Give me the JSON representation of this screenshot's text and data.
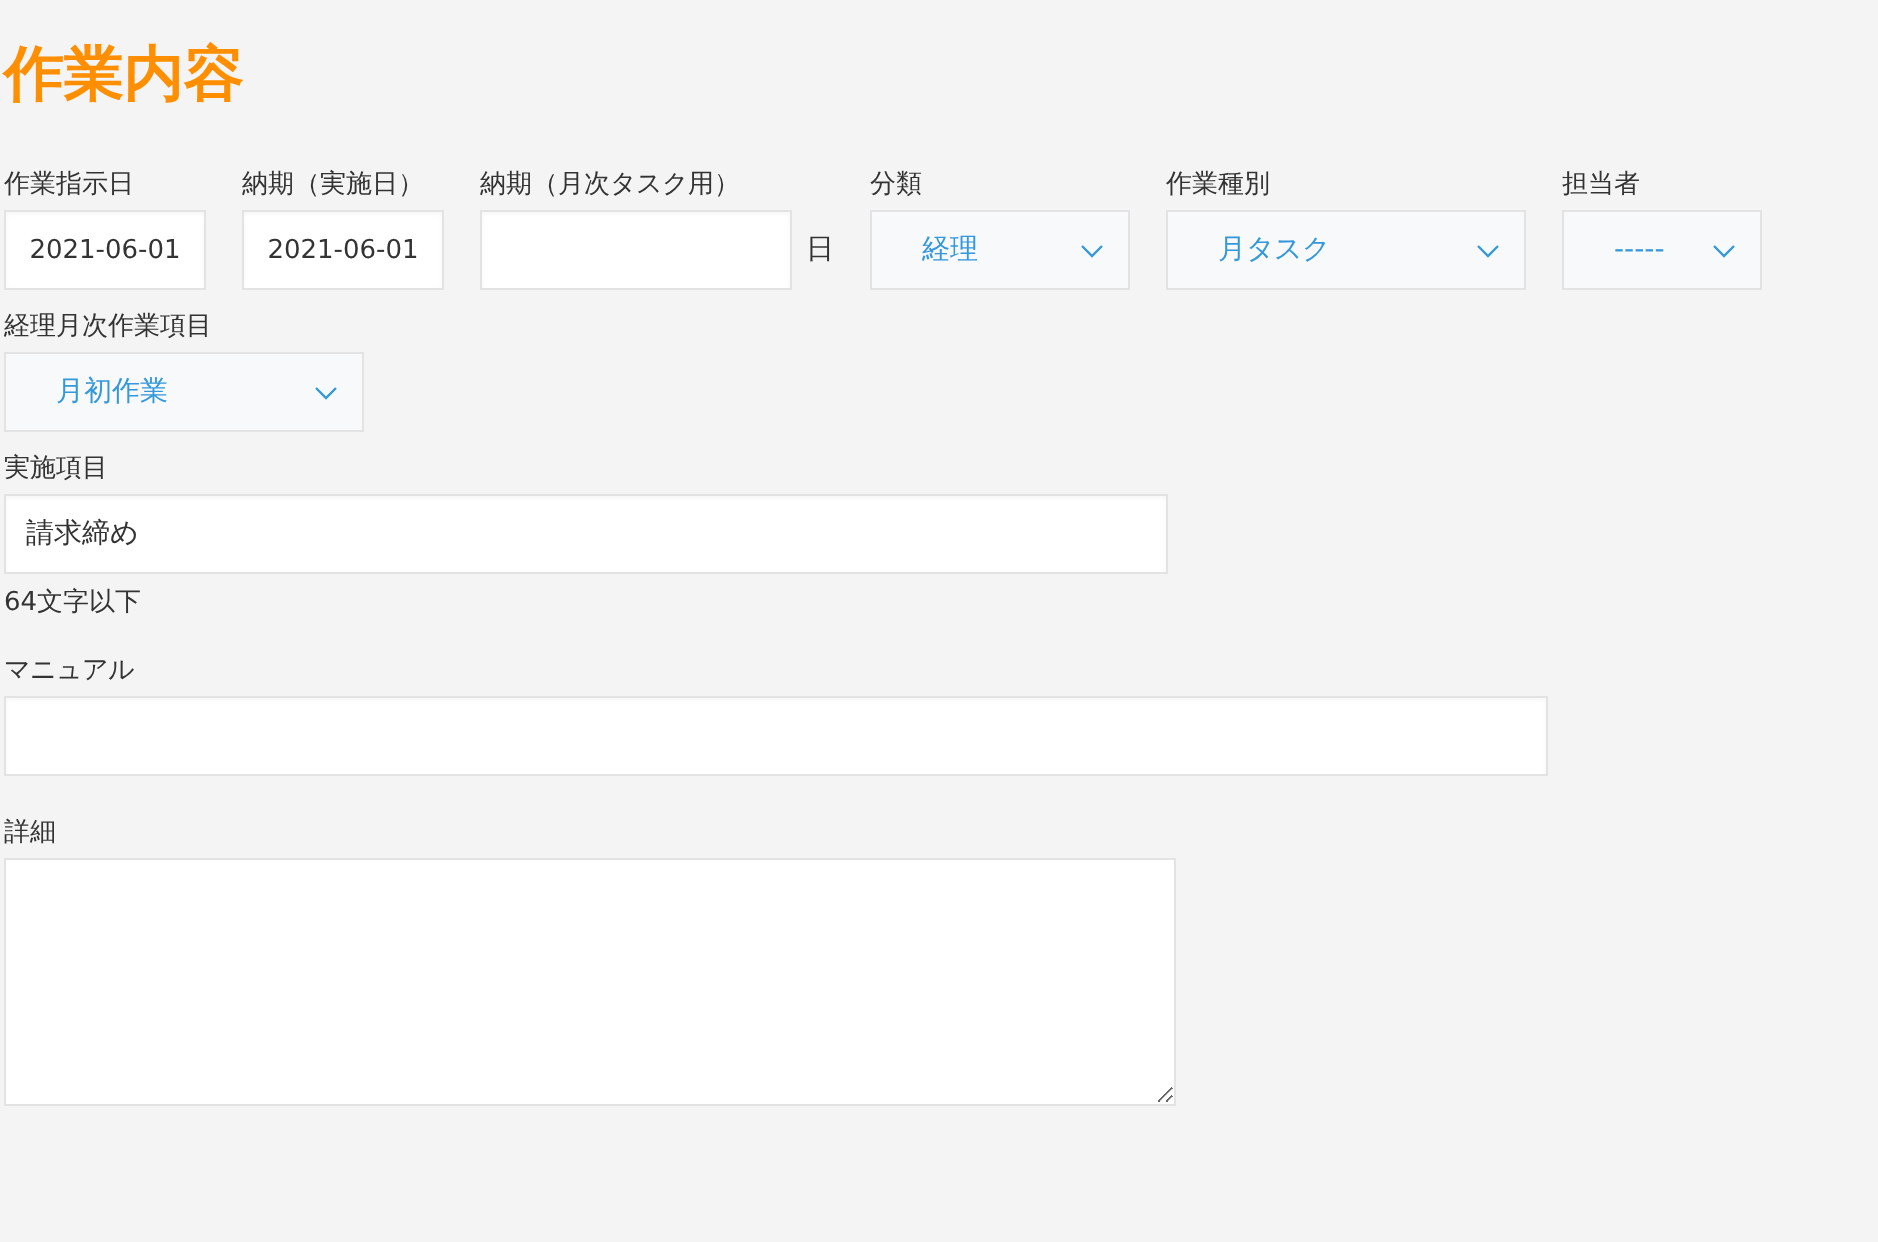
{
  "title": "作業内容",
  "row": [
    {
      "kind": "date",
      "label": "作業指示日",
      "value": "2021-06-01"
    },
    {
      "kind": "date",
      "label": "納期（実施日）",
      "value": "2021-06-01"
    },
    {
      "kind": "day",
      "label": "納期（月次タスク用）",
      "suffix": "日"
    },
    {
      "kind": "select",
      "label": "分類",
      "value": "経理"
    },
    {
      "kind": "select",
      "label": "作業種別",
      "value": "月タスク"
    },
    {
      "kind": "select",
      "label": "担当者",
      "value": "-----"
    }
  ],
  "monthly_item": {
    "label": "経理月次作業項目",
    "value": "月初作業"
  },
  "item": {
    "label": "実施項目",
    "value": "請求締め",
    "hint": "64文字以下"
  },
  "manual": {
    "label": "マニュアル"
  },
  "detail": {
    "label": "詳細"
  }
}
